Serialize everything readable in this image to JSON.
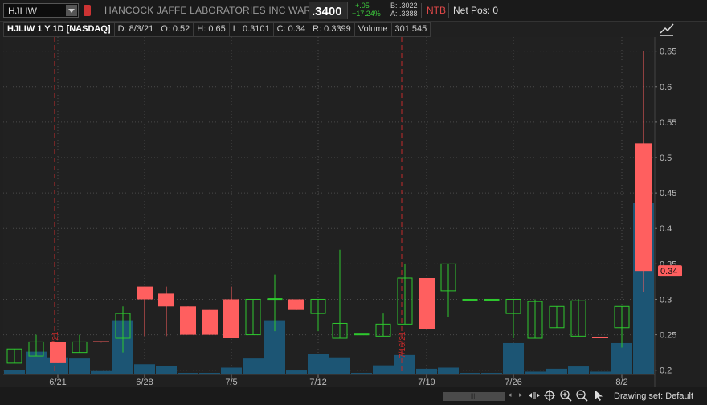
{
  "header": {
    "symbol": "HJLIW",
    "company": "HANCOCK JAFFE LABORATORIES INC WARRANT",
    "last_price": ".3400",
    "change": "+.05",
    "change_pct": "+17.24%",
    "bid": "B: .3022",
    "ask": "A: .3388",
    "ntb": "NTB",
    "net_pos": "Net Pos: 0"
  },
  "info": {
    "title": "HJLIW 1 Y 1D [NASDAQ]",
    "date": "D: 8/3/21",
    "open": "O: 0.52",
    "high": "H: 0.65",
    "low": "L: 0.3101",
    "close": "C: 0.34",
    "range": "R: 0.3399",
    "volume_label": "Volume",
    "volume_value": "301,545"
  },
  "colors": {
    "up": "#2ec92e",
    "down": "#ff5f5f",
    "volume": "#1c5574",
    "marker": "#c42a2a",
    "price_label": "#ff5f5f"
  },
  "chart_data": {
    "type": "candlestick",
    "y_ticks": [
      0.2,
      0.25,
      0.3,
      0.35,
      0.4,
      0.45,
      0.5,
      0.55,
      0.6,
      0.65
    ],
    "ylim": [
      0.194,
      0.67
    ],
    "x_tick_labels": [
      {
        "label": "6/21",
        "index": 2
      },
      {
        "label": "6/28",
        "index": 6
      },
      {
        "label": "7/5",
        "index": 10
      },
      {
        "label": "7/12",
        "index": 14
      },
      {
        "label": "7/19",
        "index": 19
      },
      {
        "label": "7/26",
        "index": 23
      },
      {
        "label": "8/2",
        "index": 28
      }
    ],
    "markers": [
      {
        "label": "6/21/21",
        "index": 2
      },
      {
        "label": "7/16/21",
        "index": 18
      }
    ],
    "last_price_label": "0.34",
    "candles": [
      {
        "o": 0.21,
        "h": 0.23,
        "l": 0.21,
        "c": 0.23,
        "v": 8000
      },
      {
        "o": 0.22,
        "h": 0.25,
        "l": 0.22,
        "c": 0.24,
        "v": 40000
      },
      {
        "o": 0.24,
        "h": 0.24,
        "l": 0.21,
        "c": 0.21,
        "v": 30000
      },
      {
        "o": 0.225,
        "h": 0.25,
        "l": 0.225,
        "c": 0.24,
        "v": 28000
      },
      {
        "o": 0.241,
        "h": 0.241,
        "l": 0.239,
        "c": 0.24,
        "v": 6000
      },
      {
        "o": 0.245,
        "h": 0.29,
        "l": 0.225,
        "c": 0.28,
        "v": 95000
      },
      {
        "o": 0.318,
        "h": 0.318,
        "l": 0.248,
        "c": 0.3,
        "v": 18000
      },
      {
        "o": 0.308,
        "h": 0.318,
        "l": 0.248,
        "c": 0.29,
        "v": 15000
      },
      {
        "o": 0.29,
        "h": 0.29,
        "l": 0.25,
        "c": 0.25,
        "v": 1000
      },
      {
        "o": 0.285,
        "h": 0.285,
        "l": 0.25,
        "c": 0.25,
        "v": 1000
      },
      {
        "o": 0.3,
        "h": 0.318,
        "l": 0.245,
        "c": 0.245,
        "v": 12000
      },
      {
        "o": 0.25,
        "h": 0.3,
        "l": 0.25,
        "c": 0.3,
        "v": 28000
      },
      {
        "o": 0.3,
        "h": 0.335,
        "l": 0.255,
        "c": 0.301,
        "v": 95000
      },
      {
        "o": 0.3,
        "h": 0.3,
        "l": 0.285,
        "c": 0.285,
        "v": 7000
      },
      {
        "o": 0.28,
        "h": 0.3,
        "l": 0.255,
        "c": 0.3,
        "v": 36000
      },
      {
        "o": 0.245,
        "h": 0.37,
        "l": 0.245,
        "c": 0.266,
        "v": 30000
      },
      {
        "o": 0.25,
        "h": 0.25,
        "l": 0.25,
        "c": 0.251,
        "v": 1000
      },
      {
        "o": 0.248,
        "h": 0.28,
        "l": 0.248,
        "c": 0.265,
        "v": 16000
      },
      {
        "o": 0.265,
        "h": 0.35,
        "l": 0.265,
        "c": 0.33,
        "v": 34000
      },
      {
        "o": 0.33,
        "h": 0.33,
        "l": 0.258,
        "c": 0.258,
        "v": 10000
      },
      {
        "o": 0.312,
        "h": 0.35,
        "l": 0.275,
        "c": 0.35,
        "v": 12000
      },
      {
        "o": 0.3,
        "h": 0.3,
        "l": 0.3,
        "c": 0.3,
        "v": 1000
      },
      {
        "o": 0.3,
        "h": 0.3,
        "l": 0.3,
        "c": 0.3,
        "v": 1000
      },
      {
        "o": 0.28,
        "h": 0.3,
        "l": 0.245,
        "c": 0.3,
        "v": 55000
      },
      {
        "o": 0.245,
        "h": 0.3,
        "l": 0.245,
        "c": 0.297,
        "v": 5000
      },
      {
        "o": 0.26,
        "h": 0.29,
        "l": 0.26,
        "c": 0.29,
        "v": 10000
      },
      {
        "o": 0.248,
        "h": 0.3,
        "l": 0.248,
        "c": 0.298,
        "v": 14000
      },
      {
        "o": 0.247,
        "h": 0.247,
        "l": 0.245,
        "c": 0.245,
        "v": 5000
      },
      {
        "o": 0.26,
        "h": 0.29,
        "l": 0.232,
        "c": 0.29,
        "v": 55000
      },
      {
        "o": 0.52,
        "h": 0.65,
        "l": 0.3101,
        "c": 0.34,
        "v": 301545
      }
    ]
  },
  "bottom": {
    "drawing_set": "Drawing set: Default"
  },
  "icons": [
    "drawing-tools-icon",
    "pan-icon",
    "crosshair-icon",
    "zoom-in-icon",
    "zoom-out-icon",
    "pointer-icon"
  ]
}
